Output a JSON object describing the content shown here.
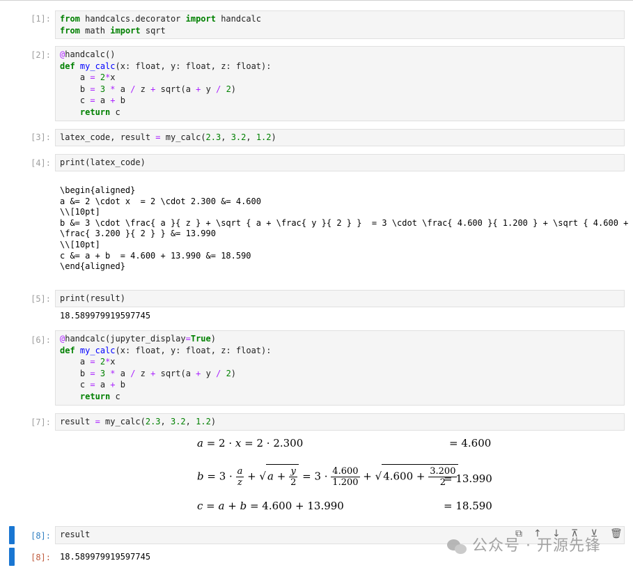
{
  "cells": {
    "c1": {
      "prompt": "[1]:"
    },
    "c2": {
      "prompt": "[2]:"
    },
    "c3": {
      "prompt": "[3]:"
    },
    "c4": {
      "prompt": "[4]:"
    },
    "c5": {
      "prompt": "[5]:",
      "output": "18.589979919597745"
    },
    "c6": {
      "prompt": "[6]:"
    },
    "c7": {
      "prompt": "[7]:"
    },
    "c8": {
      "prompt_in": "[8]:",
      "code": "result",
      "prompt_out": "[8]:",
      "output": "18.589979919597745"
    }
  },
  "latex_output": "\\begin{aligned}\na &= 2 \\cdot x  = 2 \\cdot 2.300 &= 4.600\n\\\\[10pt]\nb &= 3 \\cdot \\frac{ a }{ z } + \\sqrt { a + \\frac{ y }{ 2 } }  = 3 \\cdot \\frac{ 4.600 }{ 1.200 } + \\sqrt { 4.600 +\n\\frac{ 3.200 }{ 2 } } &= 13.990\n\\\\[10pt]\nc &= a + b  = 4.600 + 13.990 &= 18.590\n\\end{aligned}",
  "math": {
    "row_a_result": "= 4.600",
    "row_b_result": "= 13.990",
    "row_c_result": "= 18.590",
    "v_2300": "2.300",
    "v_4600": "4.600",
    "v_1200": "1.200",
    "v_3200": "3.200",
    "v_13990": "13.990"
  },
  "toolbar": {
    "icons": [
      "copy-icon",
      "move-up-icon",
      "move-down-icon",
      "insert-above-icon",
      "insert-below-icon",
      "delete-icon"
    ]
  },
  "watermark": {
    "text": "公众号 · 开源先锋"
  }
}
